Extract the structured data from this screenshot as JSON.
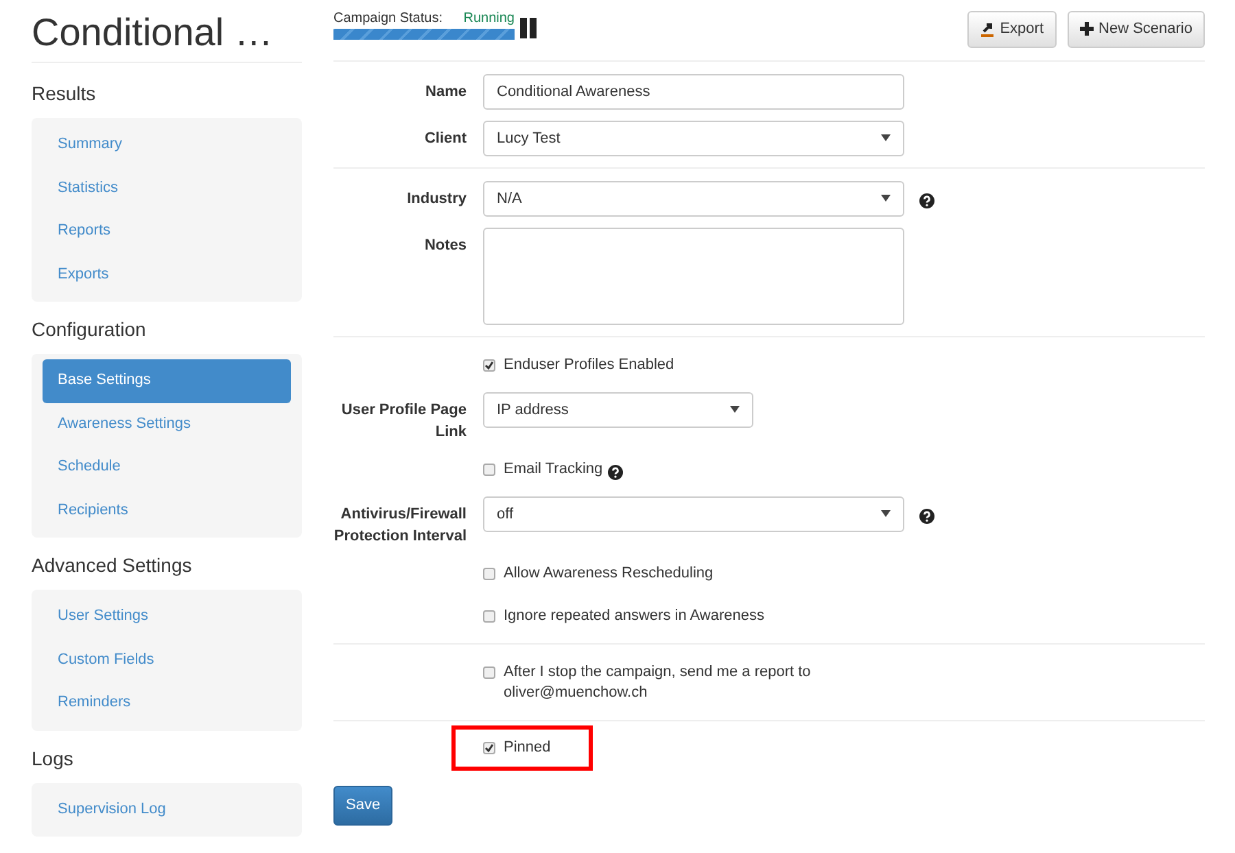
{
  "header": {
    "title": "Conditional …",
    "status_label": "Campaign Status:",
    "status_value": "Running",
    "level": 1,
    "buttons": [
      {
        "label": "Export",
        "kind": "export"
      },
      {
        "label": "New Scenario",
        "kind": "plus"
      }
    ]
  },
  "sidebar": [
    {
      "heading": "Results",
      "items": [
        {
          "label": "Summary",
          "selected": false
        },
        {
          "label": "Statistics",
          "selected": false
        },
        {
          "label": "Reports",
          "selected": false
        },
        {
          "label": "Exports",
          "selected": false
        }
      ]
    },
    {
      "heading": "Configuration",
      "items": [
        {
          "label": "Base Settings",
          "selected": true
        },
        {
          "label": "Awareness Settings",
          "selected": false
        },
        {
          "label": "Schedule",
          "selected": false
        },
        {
          "label": "Recipients",
          "selected": false
        }
      ]
    },
    {
      "heading": "Advanced Settings",
      "items": [
        {
          "label": "User Settings",
          "selected": false
        },
        {
          "label": "Custom Fields",
          "selected": false
        },
        {
          "label": "Reminders",
          "selected": false
        }
      ]
    },
    {
      "heading": "Logs",
      "items": [
        {
          "label": "Supervision Log",
          "selected": false
        }
      ]
    }
  ],
  "form": [
    [
      {
        "kind": "text",
        "label": "Name",
        "value": "Conditional Awareness"
      },
      {
        "kind": "select",
        "label": "Client",
        "value": "Lucy Test"
      }
    ],
    [
      {
        "kind": "select",
        "label": "Industry",
        "value": "N/A",
        "help": true
      },
      {
        "kind": "textarea",
        "label": "Notes"
      }
    ],
    [
      {
        "kind": "checkbox",
        "text": "Enduser Profiles Enabled",
        "checked": true
      },
      {
        "kind": "short-select",
        "label": "User Profile Page Link",
        "value": "IP address"
      },
      {
        "kind": "checkbox",
        "text": "Email Tracking",
        "checked": false,
        "help": true
      },
      {
        "kind": "select",
        "label": "Antivirus/Firewall Protection Interval",
        "value": "off",
        "help": true
      },
      {
        "kind": "checkbox",
        "text": "Allow Awareness Rescheduling",
        "checked": false
      },
      {
        "kind": "checkbox",
        "text": "Ignore repeated answers in Awareness",
        "checked": false
      }
    ],
    [
      {
        "kind": "checkbox",
        "text": "After I stop the campaign, send me a report to oliver@muenchow.ch",
        "checked": false
      }
    ],
    [
      {
        "kind": "checkbox",
        "text": "Pinned",
        "checked": true,
        "highlighted": true
      }
    ]
  ],
  "save": "Save"
}
